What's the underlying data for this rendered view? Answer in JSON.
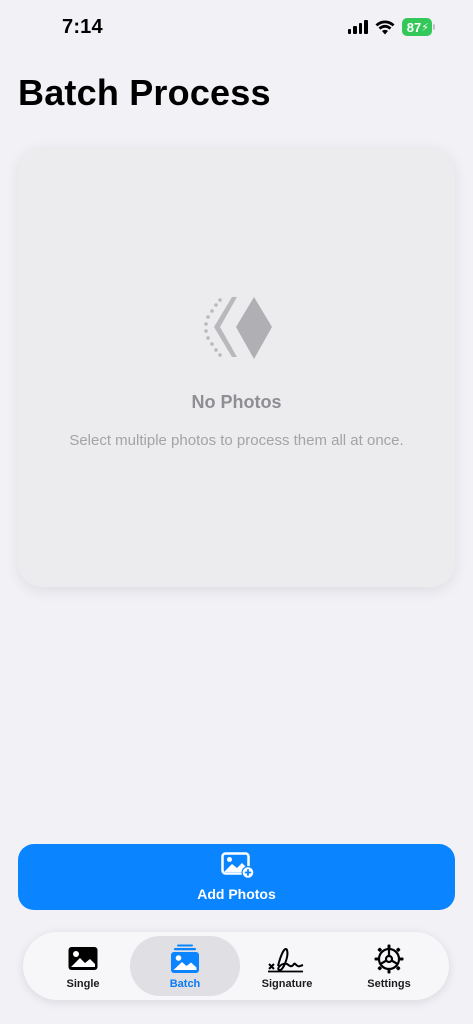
{
  "status_bar": {
    "time": "7:14",
    "battery": "87"
  },
  "page": {
    "title": "Batch Process"
  },
  "empty_state": {
    "icon": "stacked-diamond-icon",
    "title": "No Photos",
    "subtitle": "Select multiple photos to process them all at once."
  },
  "add_button": {
    "icon": "photo-add-icon",
    "label": "Add Photos"
  },
  "tab_bar": {
    "tabs": [
      {
        "label": "Single",
        "icon": "photo-icon"
      },
      {
        "label": "Batch",
        "icon": "photo-stack-icon"
      },
      {
        "label": "Signature",
        "icon": "signature-icon"
      },
      {
        "label": "Settings",
        "icon": "gear-icon"
      }
    ],
    "selected": "Batch"
  },
  "colors": {
    "accent": "#0a84ff",
    "battery": "#34c759",
    "background": "#f1f1f6"
  }
}
